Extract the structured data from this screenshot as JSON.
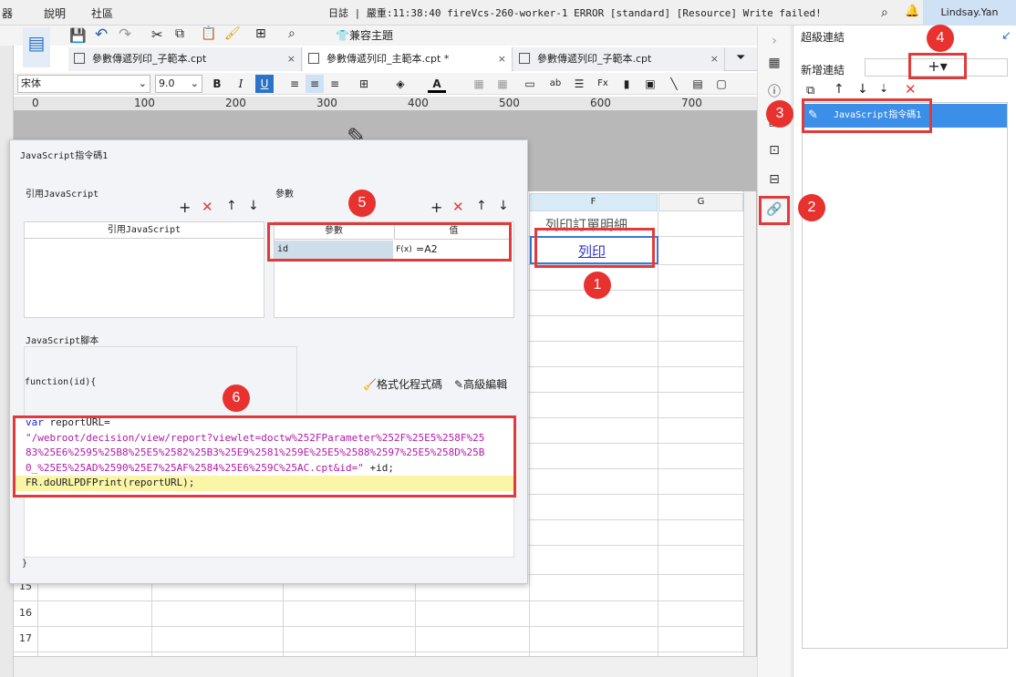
{
  "menu": {
    "item1": "器",
    "item2": "說明",
    "item3": "社區"
  },
  "status_text": "日誌 | 嚴重:11:38:40 fireVcs-260-worker-1 ERROR [standard] [Resource] Write failed!",
  "user": "Lindsay.Yan",
  "toolbar": {
    "compat_theme": "兼容主題"
  },
  "tabs": [
    {
      "label": "參數傳遞列印_子範本.cpt",
      "close": "×"
    },
    {
      "label": "參數傳遞列印_主範本.cpt *",
      "close": "×"
    },
    {
      "label": "參數傳遞列印_子範本.cpt",
      "close": "×"
    }
  ],
  "format": {
    "font": "宋体",
    "size": "9.0",
    "bold": "B",
    "italic": "I",
    "underline": "U"
  },
  "ruler": [
    "0",
    "100",
    "200",
    "300",
    "400",
    "500",
    "600",
    "700"
  ],
  "sheet": {
    "col_f": "F",
    "col_g": "G",
    "cell_title": "列印訂單明細",
    "cell_link": "列印",
    "rows": [
      "15",
      "16",
      "17"
    ]
  },
  "panel": {
    "title": "超級連結",
    "add_label": "新增連結",
    "add_button": "+▾",
    "item": "JavaScript指令碼1"
  },
  "dialog": {
    "title": "JavaScript指令碼1",
    "ref_js": "引用JavaScript",
    "ref_js_header": "引用JavaScript",
    "params": "參數",
    "param_col": "參數",
    "value_col": "值",
    "param_name": "id",
    "param_value": "=A2",
    "param_fx": "F(x)",
    "script_label": "JavaScript腳本",
    "fn_header": "function(id){",
    "fn_footer": "}",
    "format_code": "格式化程式碼",
    "advanced_edit": "高級編輯",
    "code": {
      "kw": "var",
      "line1_rest": " reportURL=",
      "line2": "\"/webroot/decision/view/report?viewlet=doctw%252FParameter%252F%25E5%258F%25",
      "line3": "83%25E6%2595%25B8%25E5%2582%25B3%25E9%2581%259E%25E5%2588%2597%25E5%258D%25B",
      "line4": "0_%25E5%25AD%2590%25E7%25AF%2584%25E6%259C%25AC.cpt&id=\"",
      "line4_rest": " +id;",
      "line5": "FR.doURLPDFPrint(reportURL);"
    }
  },
  "badges": [
    "1",
    "2",
    "3",
    "4",
    "5",
    "6"
  ],
  "colors": {
    "highlight": "#e23a3a",
    "selected": "#3b8fe8",
    "badge": "#e8322f"
  }
}
